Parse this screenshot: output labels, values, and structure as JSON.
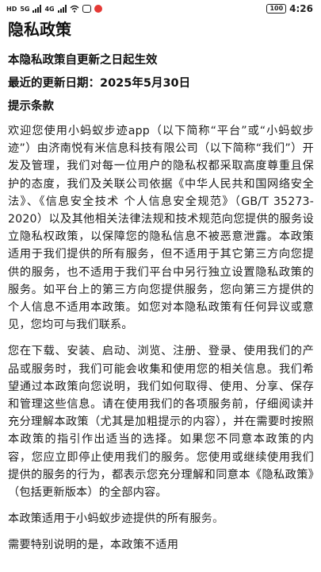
{
  "status_bar": {
    "left_badge": "HD",
    "network_1": "5G",
    "network_2": "4G",
    "battery": "100",
    "time": "4:26"
  },
  "page": {
    "title": "隐私政策",
    "effective_notice": "本隐私政策自更新之日起生效",
    "updated_date": "最近的更新日期：2025年5月30日",
    "section_title": "提示条款",
    "paragraphs": [
      "欢迎您使用小蚂蚁步迹app（以下简称“平台”或“小蚂蚁步迹”）由济南悦有米信息科技有限公司（以下简称“我们”）开发及管理，我们对每一位用户的隐私权都采取高度尊重且保护的态度，我们及关联公司依据《中华人民共和国网络安全法》、《信息安全技术 个人信息安全规范》（GB/T 35273-2020）以及其他相关法律法规和技术规范向您提供的服务设立隐私权政策，以保障您的隐私信息不被恶意泄露。本政策适用于我们提供的所有服务，但不适用于其它第三方向您提供的服务，也不适用于我们平台中另行独立设置隐私政策的服务。如平台上的第三方向您提供服务，您向第三方提供的个人信息不适用本政策。如您对本隐私政策有任何异议或意见，您均可与我们联系。",
      "您在下载、安装、启动、浏览、注册、登录、使用我们的产品或服务时，我们可能会收集和使用您的相关信息。我们希望通过本政策向您说明，我们如何取得、使用、分享、保存和管理这些信息。请在使用我们的各项服务前，仔细阅读并充分理解本政策（尤其是加粗提示的内容），并在需要时按照本政策的指引作出适当的选择。如果您不同意本政策的内容，您应立即停止使用我们的服务。您使用或继续使用我们提供的服务的行为，都表示您充分理解和同意本《隐私政策》（包括更新版本）的全部内容。",
      "本政策适用于小蚂蚁步迹提供的所有服务。",
      "需要特别说明的是，本政策不适用"
    ]
  }
}
